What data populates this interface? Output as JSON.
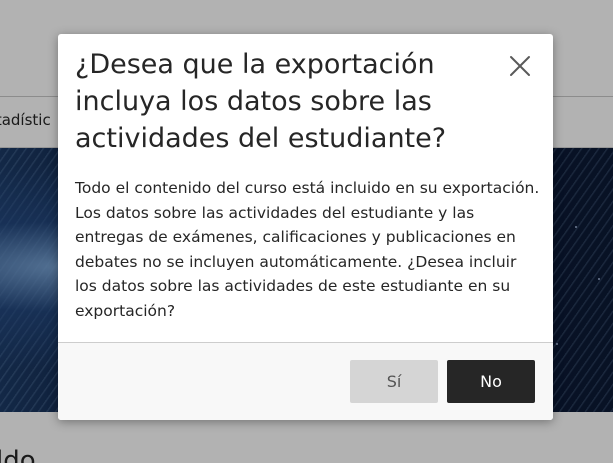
{
  "background": {
    "nav_item_label": "stadístic"
  },
  "dialog": {
    "title": "¿Desea que la exportación incluya los datos sobre las actividades del estudiante?",
    "close_icon": "close-icon",
    "body": "Todo el contenido del curso está incluido en su exportación. Los datos sobre las actividades del estudiante y las entregas de exámenes, calificaciones y publicaciones en debates no se incluyen automáticamente. ¿Desea incluir los datos sobre las actividades de este estudiante en su exportación?",
    "yes_label": "Sí",
    "no_label": "No"
  },
  "colors": {
    "primary_button": "#262626",
    "secondary_button": "#d5d5d5",
    "overlay": "rgba(0,0,0,0.3)"
  }
}
